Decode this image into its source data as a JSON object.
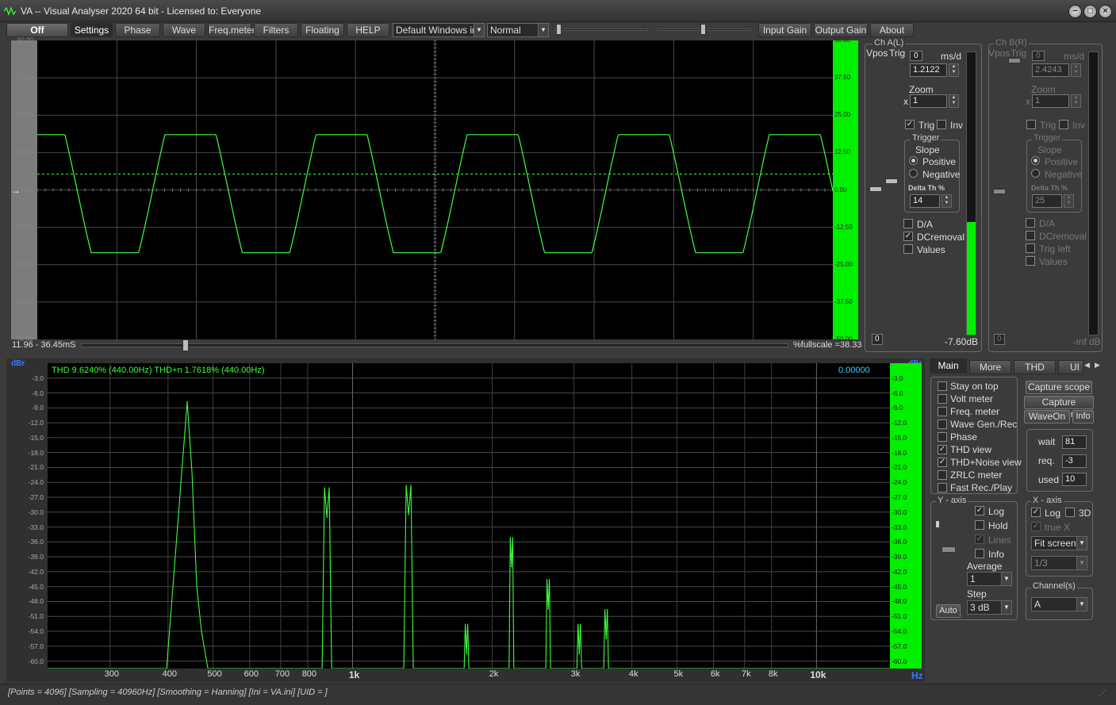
{
  "app_title": "VA -- Visual Analyser 2020 64 bit - Licensed to: Everyone",
  "window_controls": {
    "minimize": "−",
    "maximize": "□",
    "close": "×"
  },
  "toolbar": {
    "off": "Off",
    "settings": "Settings",
    "phase": "Phase",
    "wave": "Wave",
    "freq_meter": "Freq.meter",
    "filters": "Filters",
    "floating": "Floating",
    "help": "HELP",
    "input_device": "Default Windows inp",
    "mode": "Normal",
    "input_gain": "Input Gain",
    "output_gain": "Output Gain",
    "about": "About"
  },
  "scope": {
    "y_ticks": [
      "50.00",
      "37.50",
      "25.00",
      "12.50",
      "0.00",
      "-12.50",
      "-25.00",
      "-37.50",
      "-50.00"
    ],
    "time_range": "11.96 - 36.45mS",
    "fullscale": "%fullscale =38.33",
    "y_range": [
      -50,
      50
    ]
  },
  "chA": {
    "title": "Ch A(L)",
    "vpos": "Vpos",
    "trig_label": "Trig",
    "ms_zero": "0",
    "msd": "ms/d",
    "ms_value": "1.2122",
    "zoom": "Zoom",
    "zoom_x": "x",
    "zoom_value": "1",
    "trig": "Trig",
    "inv": "Inv",
    "trigger": "Trigger",
    "slope": "Slope",
    "positive": "Positive",
    "negative": "Negative",
    "delta_th": "Delta Th %",
    "delta_value": "14",
    "da": "D/A",
    "dcremoval": "DCremoval",
    "values": "Values",
    "bottom_zero": "0",
    "level": "-7.60dB",
    "level_fraction": 0.4
  },
  "chB": {
    "title": "Ch B(R)",
    "vpos": "Vpos",
    "trig_label": "Trig",
    "ms_zero": "0",
    "msd": "ms/d",
    "ms_value": "2.4243",
    "zoom": "Zoom",
    "zoom_x": "x",
    "zoom_value": "1",
    "trig": "Trig",
    "inv": "Inv",
    "trigger": "Trigger",
    "slope": "Slope",
    "positive": "Positive",
    "negative": "Negative",
    "delta_th": "Delta Th %",
    "delta_value": "25",
    "da": "D/A",
    "dcremoval": "DCremoval",
    "trig_left": "Trig left",
    "values": "Values",
    "bottom_zero": "0",
    "level": "-inf dB"
  },
  "spectrum": {
    "unit_left": "dBr",
    "unit_right": "dBr",
    "unit_x": "Hz",
    "thd_text": "THD 9.6240% (440.00Hz) THD+n 1.7618% (440.00Hz)",
    "readout": "0.00000",
    "y_ticks": [
      "-3.0",
      "-6.0",
      "-9.0",
      "-12.0",
      "-15.0",
      "-18.0",
      "-21.0",
      "-24.0",
      "-27.0",
      "-30.0",
      "-33.0",
      "-36.0",
      "-39.0",
      "-42.0",
      "-45.0",
      "-48.0",
      "-51.0",
      "-54.0",
      "-57.0",
      "-60.0"
    ],
    "x_ticks": [
      {
        "label": "300",
        "f": 300,
        "bold": false
      },
      {
        "label": "400",
        "f": 400,
        "bold": false
      },
      {
        "label": "500",
        "f": 500,
        "bold": false
      },
      {
        "label": "600",
        "f": 600,
        "bold": false
      },
      {
        "label": "700",
        "f": 700,
        "bold": false
      },
      {
        "label": "800",
        "f": 800,
        "bold": false
      },
      {
        "label": "1k",
        "f": 1000,
        "bold": true
      },
      {
        "label": "2k",
        "f": 2000,
        "bold": false
      },
      {
        "label": "3k",
        "f": 3000,
        "bold": false
      },
      {
        "label": "4k",
        "f": 4000,
        "bold": false
      },
      {
        "label": "5k",
        "f": 5000,
        "bold": false
      },
      {
        "label": "6k",
        "f": 6000,
        "bold": false
      },
      {
        "label": "7k",
        "f": 7000,
        "bold": false
      },
      {
        "label": "8k",
        "f": 8000,
        "bold": false
      },
      {
        "label": "10k",
        "f": 10000,
        "bold": true
      }
    ]
  },
  "chart_data": {
    "type": "line",
    "xlabel": "Hz",
    "ylabel": "dBr",
    "xscale": "log",
    "ylim": [
      -61.5,
      0
    ],
    "series": [
      {
        "values": [
          [
            440,
            -7.8
          ],
          [
            880,
            -31.0
          ],
          [
            1320,
            -30.5
          ],
          [
            1760,
            -58.5
          ],
          [
            2200,
            -41.0
          ],
          [
            2640,
            -49.5
          ],
          [
            3080,
            -58.5
          ],
          [
            3520,
            -55.5
          ]
        ]
      }
    ]
  },
  "tabs": {
    "main": "Main",
    "more": "More",
    "thd": "THD",
    "ui": "UI"
  },
  "main": {
    "items": [
      {
        "label": "Stay on top",
        "checked": false
      },
      {
        "label": "Volt meter",
        "checked": false
      },
      {
        "label": "Freq. meter",
        "checked": false
      },
      {
        "label": "Wave Gen./Rec",
        "checked": false
      },
      {
        "label": "Phase",
        "checked": false
      },
      {
        "label": "THD view",
        "checked": true
      },
      {
        "label": "THD+Noise view",
        "checked": true
      },
      {
        "label": "ZRLC meter",
        "checked": false
      },
      {
        "label": "Fast Rec./Play",
        "checked": false
      }
    ],
    "capture_scope": "Capture scope",
    "capture_spectrum": "Capture spectrum",
    "waveon": "WaveOn",
    "info": "Info",
    "wait": "wait",
    "wait_value": "81",
    "req": "req.",
    "req_value": "-3",
    "used": "used",
    "used_value": "10"
  },
  "yaxis": {
    "title": "Y - axis",
    "log": "Log",
    "hold": "Hold",
    "lines": "Lines",
    "info": "Info",
    "average": "Average",
    "average_value": "1",
    "step": "Step",
    "step_value": "3 dB",
    "auto": "Auto"
  },
  "xaxis": {
    "title": "X - axis",
    "log": "Log",
    "threed": "3D",
    "truex": "true X",
    "fit": "Fit screen",
    "octave": "1/3"
  },
  "channels": {
    "title": "Channel(s)",
    "value": "A"
  },
  "status": "[Points = 4096]  [Sampling = 40960Hz]  [Smoothing = Hanning]  [Ini = VA.ini]  [UID = ]",
  "colors": {
    "trace": "#3cff3c",
    "meter": "#00f000",
    "bg": "#000000",
    "grid": "#4a4a4a"
  }
}
